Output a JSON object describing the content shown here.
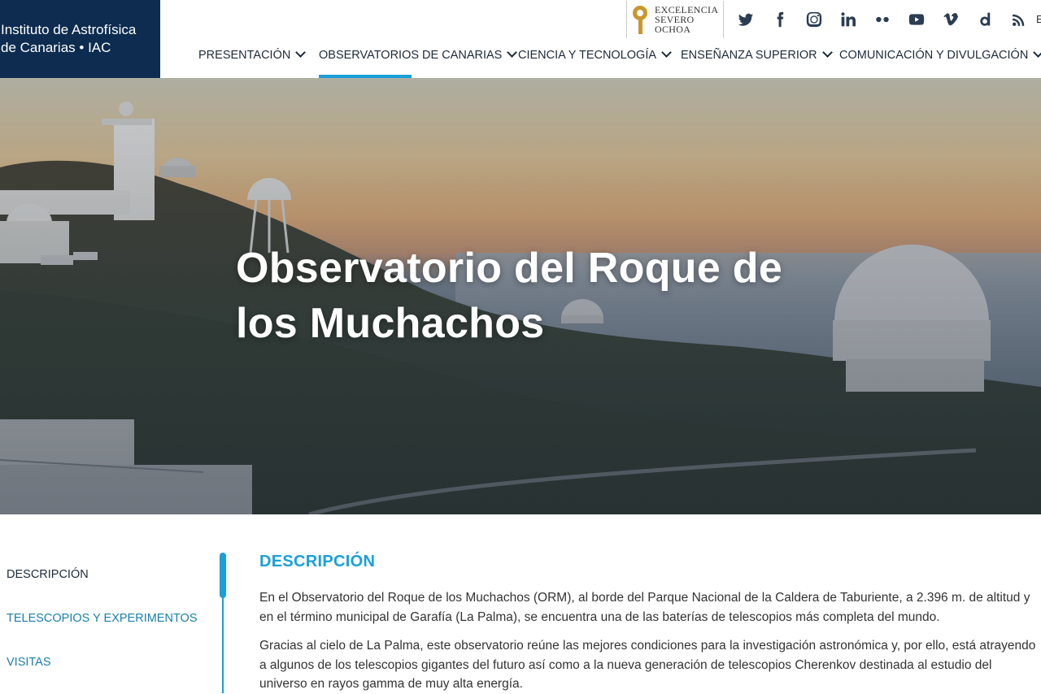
{
  "header": {
    "logo_line1": "Instituto de Astrofísica",
    "logo_line2": "de Canarias • IAC",
    "severo_ochoa": [
      "EXCELENCIA",
      "SEVERO",
      "OCHOA"
    ],
    "social_icons": [
      "twitter-icon",
      "facebook-icon",
      "instagram-icon",
      "linkedin-icon",
      "flickr-icon",
      "youtube-icon",
      "vimeo-icon",
      "dailymotion-icon",
      "podcast-icon"
    ],
    "edge_char": "E"
  },
  "nav": {
    "items": [
      {
        "label": "PRESENTACIÓN"
      },
      {
        "label": "OBSERVATORIOS DE CANARIAS"
      },
      {
        "label": "CIENCIA Y TECNOLOGÍA"
      },
      {
        "label": "ENSEÑANZA SUPERIOR"
      },
      {
        "label": "COMUNICACIÓN Y DIVULGACIÓN"
      }
    ],
    "active_index": 1
  },
  "hero": {
    "title_line1": "Observatorio del Roque de",
    "title_line2": "los Muchachos"
  },
  "sidebar": {
    "items": [
      {
        "label": "DESCRIPCIÓN"
      },
      {
        "label": "TELESCOPIOS Y EXPERIMENTOS"
      },
      {
        "label": "VISITAS"
      }
    ]
  },
  "main": {
    "heading": "DESCRIPCIÓN",
    "paragraph1": "En el Observatorio del Roque de los Muchachos (ORM), al borde del Parque Nacional de la Caldera de Taburiente, a 2.396 m. de altitud y en el término municipal de Garafía (La Palma), se encuentra una de las baterías de telescopios más completa del mundo.",
    "paragraph2": "Gracias al cielo de La Palma, este observatorio reúne las mejores condiciones para la investigación astronómica y, por ello, está atrayendo a algunos de los telescopios gigantes del futuro así como a la nueva generación de telescopios Cherenkov destinada al estudio del universo en rayos gamma de muy alta energía."
  },
  "colors": {
    "navy": "#0d2c4f",
    "accent": "#1aa0d8",
    "link": "#1a7fa8",
    "gold": "#c9972b"
  }
}
